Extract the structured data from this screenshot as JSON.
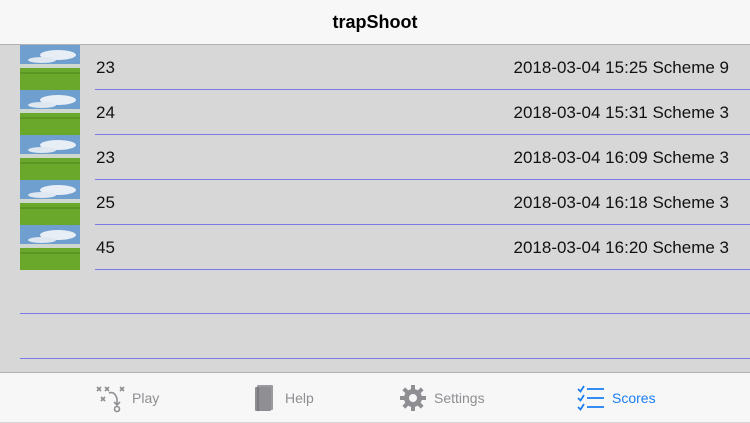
{
  "app": {
    "title": "trapShoot"
  },
  "scores": [
    {
      "score": "23",
      "info": "2018-03-04 15:25 Scheme 9"
    },
    {
      "score": "24",
      "info": "2018-03-04 15:31 Scheme 3"
    },
    {
      "score": "23",
      "info": "2018-03-04 16:09 Scheme 3"
    },
    {
      "score": "25",
      "info": "2018-03-04 16:18 Scheme 3"
    },
    {
      "score": "45",
      "info": "2018-03-04 16:20 Scheme 3"
    }
  ],
  "tabs": [
    {
      "label": "Play",
      "icon": "play-playbook-icon"
    },
    {
      "label": "Help",
      "icon": "book-icon"
    },
    {
      "label": "Settings",
      "icon": "gear-icon"
    },
    {
      "label": "Scores",
      "icon": "checklist-icon",
      "active": true
    }
  ],
  "colors": {
    "accent": "#1a7ef0",
    "separator": "#7a7ae6",
    "background": "#d7d7d7"
  }
}
